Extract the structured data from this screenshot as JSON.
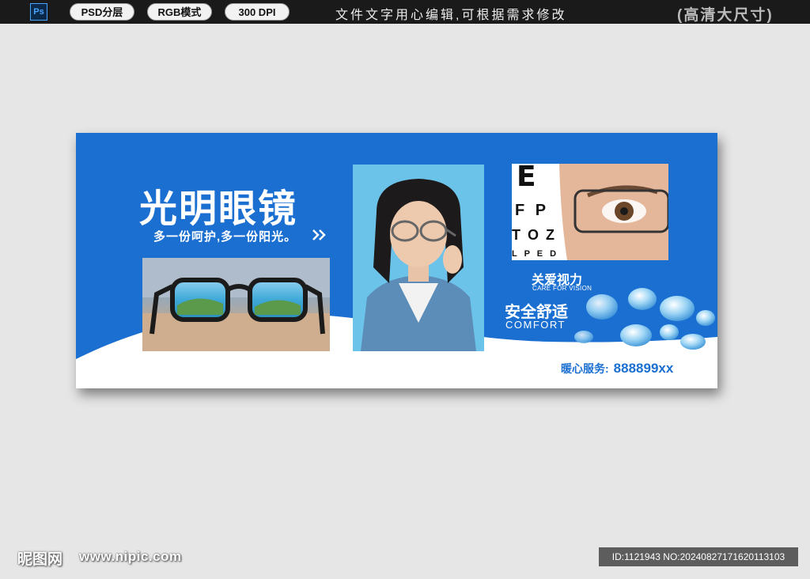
{
  "topbar": {
    "ps_icon": "Ps",
    "badges": [
      "PSD分层",
      "RGB模式",
      "300 DPI"
    ],
    "note": "文件文字用心编辑,可根据需求修改",
    "size_label": "(高清大尺寸)"
  },
  "banner": {
    "title": "光明眼镜",
    "slogan": "多一份呵护,多一份阳光。",
    "care_title": "关爱视力",
    "care_sub": "CARE FOR VISION",
    "comfort_title": "安全舒适",
    "comfort_sub": "COMFORT",
    "hotline_label": "暖心服务:",
    "hotline_number": "888899xx",
    "eye_chart_letters": [
      "E",
      "F P",
      "T O Z",
      "L P E D"
    ]
  },
  "colors": {
    "brand_blue": "#1a6fd1",
    "page_bg": "#e6e6e6",
    "topbar_bg": "#1a1a1a"
  },
  "watermark": {
    "logo": "昵图网",
    "url": "www.nipic.com",
    "id_text": "ID:1121943 NO:20240827171620113103"
  }
}
